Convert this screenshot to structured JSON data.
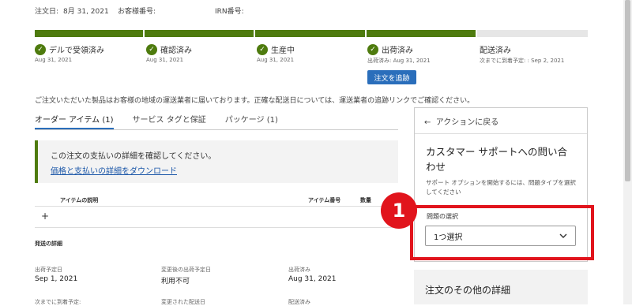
{
  "header": {
    "order_date_label": "注文日:",
    "order_date_value": "8月 31, 2021",
    "customer_no_label": "お客様番号:",
    "irn_label": "IRN番号:"
  },
  "progress": {
    "steps": [
      {
        "label": "デルで受領済み",
        "date": "Aug 31, 2021"
      },
      {
        "label": "確認済み",
        "date": "Aug 31, 2021"
      },
      {
        "label": "生産中",
        "date": "Aug 31, 2021"
      },
      {
        "label": "出荷済み",
        "date": "出荷済み: Aug 31, 2021"
      },
      {
        "label": "配送済み",
        "date": "次までに到着予定: : Sep 2, 2021"
      }
    ],
    "track_button": "注文を追跡",
    "accent_color": "#4e7b0e"
  },
  "notice": "ご注文いただいた製品はお客様の地域の運送業者に届いております。正確な配送日については、運送業者の追跡リンクでご確認ください。",
  "tabs": [
    {
      "label": "オーダー アイテム (1)"
    },
    {
      "label": "サービス タグと保証"
    },
    {
      "label": "パッケージ (1)"
    }
  ],
  "payment": {
    "message": "この注文の支払いの詳細を確認してください。",
    "link": "価格と支払いの詳細をダウンロード"
  },
  "items_table": {
    "headers": [
      "アイテムの説明",
      "アイテム番号",
      "数量"
    ],
    "expand_symbol": "+"
  },
  "shipping": {
    "title": "発送の詳細",
    "fields": [
      {
        "label": "出荷予定日",
        "value": "Sep 1, 2021"
      },
      {
        "label": "変更後の出荷予定日",
        "value": "利用不可"
      },
      {
        "label": "出荷済み",
        "value": "Aug 31, 2021"
      },
      {
        "label": "次までに到着予定:",
        "value": ""
      },
      {
        "label": "変更された配送日",
        "value": ""
      },
      {
        "label": "配送済み",
        "value": ""
      }
    ]
  },
  "support_panel": {
    "back_label": "アクションに戻る",
    "title": "カスタマー サポートへの問い合わせ",
    "description": "サポート オプションを開始するには、問題タイプを選択してください",
    "issue_label": "問題の選択",
    "select_value": "1つ選択",
    "callout_number": "1",
    "callout_color": "#e1141c"
  },
  "other_details": "注文のその他の詳細"
}
